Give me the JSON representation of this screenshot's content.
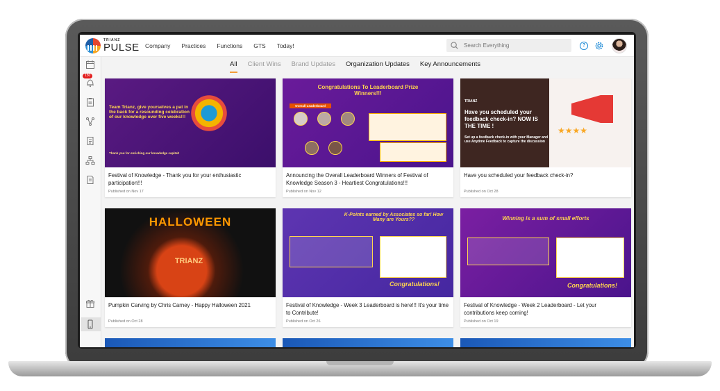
{
  "logo": {
    "small": "TRIANZ",
    "big": "PULSE"
  },
  "nav": [
    "Company",
    "Practices",
    "Functions",
    "GTS",
    "Today!"
  ],
  "search": {
    "placeholder": "Search Everything"
  },
  "help_label": "?",
  "sidebar": {
    "notification_badge": "150"
  },
  "tabs": [
    {
      "label": "All",
      "state": "active"
    },
    {
      "label": "Client Wins",
      "state": "muted"
    },
    {
      "label": "Brand Updates",
      "state": "muted"
    },
    {
      "label": "Organization Updates",
      "state": "normal"
    },
    {
      "label": "Key Announcements",
      "state": "normal"
    }
  ],
  "cards": [
    {
      "title": "Festival of Knowledge - Thank you for your enthusiastic participation!!!",
      "date": "Published on Nov 17",
      "thumb_heading": "Team Trianz, give yourselves a pat in the back for a resounding celebration of our knowledge over five weeks!!!",
      "thumb_footer": "Thank you for enriching our knowledge capital!"
    },
    {
      "title": "Announcing the Overall Leaderboard Winners of Festival of Knowledge Season 3 - Heartiest Congratulations!!!",
      "date": "Published on Nov 12",
      "thumb_heading": "Congratulations To Leaderboard Prize Winners!!!",
      "thumb_footer": "Overall Leaderboard"
    },
    {
      "title": "Have you scheduled your feedback check-in?",
      "date": "Published on Oct 28",
      "thumb_heading": "Have you scheduled your feedback check-in? NOW IS THE TIME !",
      "thumb_footer": "Set up a feedback check-in with your Manager and use Anytime Feedback to capture the discussion",
      "thumb_brand": "TRIANZ"
    },
    {
      "title": "Pumpkin Carving by Chris Carney - Happy Halloween 2021",
      "date": "Published on Oct 28",
      "thumb_heading": "HALLOWEEN",
      "thumb_footer": "TRIANZ"
    },
    {
      "title": "Festival of Knowledge - Week 3 Leaderboard is here!!! It's your time to Contribute!",
      "date": "Published on Oct 26",
      "thumb_heading": "K-Points earned by Associates so far! How Many are Yours??",
      "thumb_footer": "Congratulations!"
    },
    {
      "title": "Festival of Knowledge - Week 2 Leaderboard - Let your contributions keep coming!",
      "date": "Published on Oct 19",
      "thumb_heading": "Winning is a sum of small efforts",
      "thumb_footer": "Congratulations!"
    }
  ],
  "colors": {
    "accent": "#f29b38",
    "brand_blue": "#1d8ad6",
    "badge_red": "#e21d1d"
  }
}
